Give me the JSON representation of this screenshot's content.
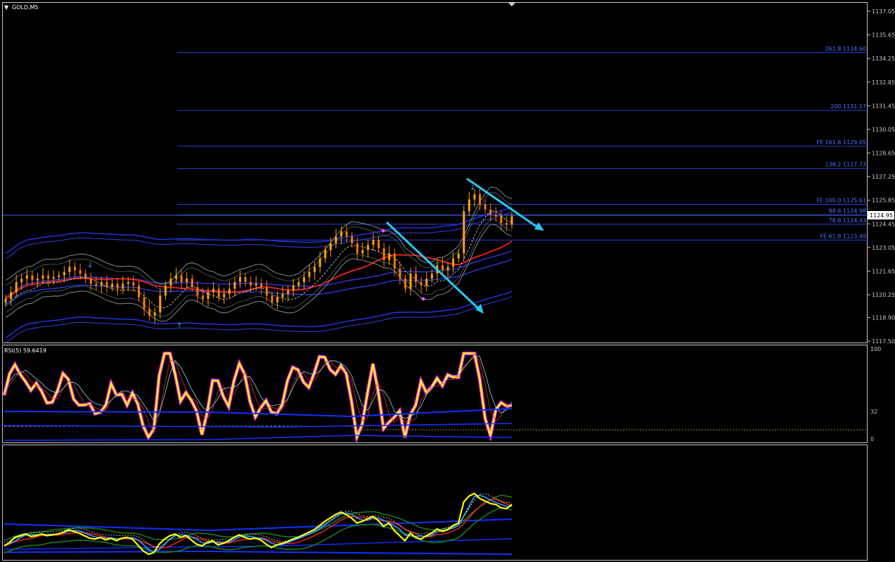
{
  "symbol_title": "GOLD,M5",
  "current_price_label": "1124.95",
  "rsi_title": "RSI(5) 59.6419",
  "rsi_levels": [
    "100",
    "32",
    "0"
  ],
  "price_ticks": [
    "1137.05",
    "1135.65",
    "1134.25",
    "1132.85",
    "1131.45",
    "1130.05",
    "1128.65",
    "1127.25",
    "1125.85",
    "1124.45",
    "1123.05",
    "1121.65",
    "1120.25",
    "1118.90",
    "1117.50"
  ],
  "fib_levels": [
    {
      "label": "261.8 1134.60",
      "price": 1134.6
    },
    {
      "label": "200 1131.17",
      "price": 1131.17
    },
    {
      "label": "FE 161.8 1129.05",
      "price": 1129.05
    },
    {
      "label": "138.2 1127.73",
      "price": 1127.73
    },
    {
      "label": "FE 100.0 1125.61",
      "price": 1125.61
    },
    {
      "label": "88.6 1124.98",
      "price": 1124.98
    },
    {
      "label": "78.6 1124.43",
      "price": 1124.43
    },
    {
      "label": "FE 61.8 1123.49",
      "price": 1123.49
    }
  ],
  "colors": {
    "background": "#000000",
    "bull_candle": "#ffa500",
    "bear_candle": "#ff7a00",
    "fib_line": "#2b3fd0",
    "trend_arrow": "#28c8f0",
    "rsi_main": "#ffff00",
    "rsi_highlight": "#ff20ff",
    "ma_red": "#e02020",
    "band_blue": "#2030d0"
  },
  "chart_data": {
    "type": "candlestick",
    "title": "GOLD,M5",
    "ylim": [
      1117.5,
      1137.4
    ],
    "close_path": [
      1120.0,
      1120.4,
      1121.0,
      1121.2,
      1121.4,
      1121.1,
      1121.2,
      1121.4,
      1121.2,
      1121.3,
      1121.4,
      1121.6,
      1121.9,
      1121.7,
      1121.5,
      1121.2,
      1120.9,
      1120.8,
      1121.0,
      1120.7,
      1120.9,
      1120.6,
      1120.9,
      1121.0,
      1120.8,
      1120.1,
      1119.4,
      1119.0,
      1119.2,
      1120.2,
      1120.8,
      1121.2,
      1121.4,
      1121.0,
      1121.2,
      1120.7,
      1120.2,
      1120.0,
      1120.4,
      1120.6,
      1120.1,
      1120.3,
      1120.6,
      1121.0,
      1121.3,
      1121.0,
      1120.8,
      1120.9,
      1120.7,
      1120.2,
      1119.8,
      1120.1,
      1120.3,
      1120.5,
      1120.8,
      1121.0,
      1121.3,
      1121.6,
      1121.9,
      1122.4,
      1122.9,
      1123.3,
      1123.7,
      1124.0,
      1123.7,
      1123.3,
      1122.7,
      1122.9,
      1123.2,
      1123.5,
      1123.0,
      1122.3,
      1122.7,
      1121.8,
      1121.2,
      1120.6,
      1121.5,
      1121.0,
      1120.8,
      1121.2,
      1121.5,
      1122.0,
      1121.7,
      1121.9,
      1122.4,
      1122.7,
      1125.2,
      1125.9,
      1126.2,
      1125.6,
      1125.3,
      1125.0,
      1124.9,
      1124.5,
      1124.4,
      1124.9
    ],
    "trend_arrows": [
      {
        "from": [
          1124.8,
          "t73"
        ],
        "to": [
          1119.1,
          "t92"
        ]
      },
      {
        "from": [
          1126.5,
          "t91"
        ],
        "to": [
          1124.3,
          "t104"
        ]
      }
    ],
    "indicators": [
      {
        "name": "RSI(5)",
        "value": 59.6419,
        "levels": [
          0,
          32,
          100
        ]
      }
    ]
  }
}
